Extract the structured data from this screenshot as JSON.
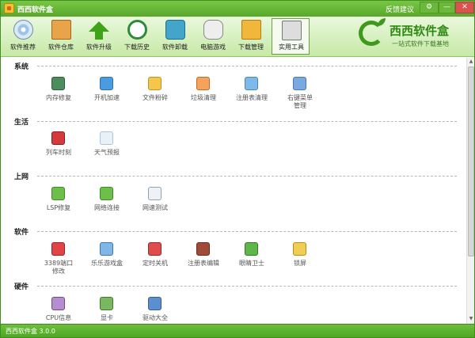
{
  "window": {
    "title": "西西软件盒",
    "feedback": "反馈建议",
    "controls": {
      "settings": "⚙",
      "minimize": "—",
      "close": "✕"
    }
  },
  "toolbar": {
    "items": [
      {
        "label": "软件推荐",
        "icon": "cd-icon"
      },
      {
        "label": "软件仓库",
        "icon": "box-icon"
      },
      {
        "label": "软件升级",
        "icon": "upgrade-arrow-icon"
      },
      {
        "label": "下载历史",
        "icon": "clock-icon"
      },
      {
        "label": "软件卸载",
        "icon": "recycle-bin-icon"
      },
      {
        "label": "电脑游戏",
        "icon": "gamepad-icon"
      },
      {
        "label": "下载管理",
        "icon": "download-folder-icon"
      },
      {
        "label": "实用工具",
        "icon": "tools-icon",
        "active": true
      }
    ],
    "logo": {
      "name": "西西软件盒",
      "slogan": "一站式软件下载基地"
    }
  },
  "sections": [
    {
      "title": "系统",
      "items": [
        {
          "label": "内存修复",
          "icon": "memory-icon"
        },
        {
          "label": "开机加速",
          "icon": "shield-icon"
        },
        {
          "label": "文件粉碎",
          "icon": "shredder-icon"
        },
        {
          "label": "垃圾清理",
          "icon": "cleanup-icon"
        },
        {
          "label": "注册表清理",
          "icon": "registry-icon"
        },
        {
          "label": "右键菜单管理",
          "icon": "star-icon"
        }
      ]
    },
    {
      "title": "生活",
      "items": [
        {
          "label": "列车时刻",
          "icon": "train-icon"
        },
        {
          "label": "天气预报",
          "icon": "weather-icon"
        }
      ]
    },
    {
      "title": "上网",
      "items": [
        {
          "label": "LSP修复",
          "icon": "lsp-icon"
        },
        {
          "label": "网络连接",
          "icon": "network-icon"
        },
        {
          "label": "网速测试",
          "icon": "speedtest-icon"
        }
      ]
    },
    {
      "title": "软件",
      "items": [
        {
          "label": "3389端口修改",
          "icon": "port-icon"
        },
        {
          "label": "乐乐游戏盒",
          "icon": "game-box-icon"
        },
        {
          "label": "定时关机",
          "icon": "power-icon"
        },
        {
          "label": "注册表编辑",
          "icon": "regedit-icon"
        },
        {
          "label": "眼睛卫士",
          "icon": "eye-icon"
        },
        {
          "label": "锁屏",
          "icon": "lock-icon"
        }
      ]
    },
    {
      "title": "硬件",
      "items": [
        {
          "label": "CPU信息",
          "icon": "cpu-icon"
        },
        {
          "label": "显卡",
          "icon": "graphics-card-icon"
        },
        {
          "label": "驱动大全",
          "icon": "driver-icon"
        }
      ]
    }
  ],
  "status": {
    "text": "西西软件盒 3.0.0"
  }
}
